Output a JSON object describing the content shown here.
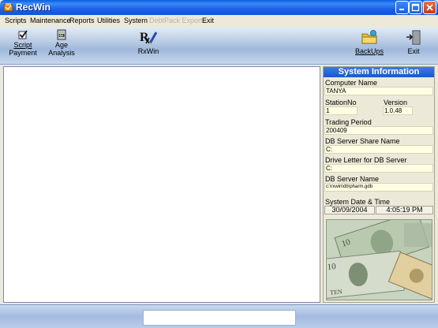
{
  "window": {
    "title": "RecWin"
  },
  "menu": {
    "items": [
      {
        "label": "Scripts",
        "enabled": true
      },
      {
        "label": "Maintenance",
        "enabled": true
      },
      {
        "label": "Reports",
        "enabled": true
      },
      {
        "label": "Utilities",
        "enabled": true
      },
      {
        "label": "System",
        "enabled": true
      },
      {
        "label": "DebtPack Exports",
        "enabled": false
      },
      {
        "label": "Exit",
        "enabled": true
      }
    ]
  },
  "toolbar": {
    "script_payment": {
      "line1": "Script",
      "line2": "Payment",
      "icon": "checkbox-icon"
    },
    "age_analysis": {
      "line1": "Age",
      "line2": "Analysis",
      "icon": "calculator-icon"
    },
    "rxwin": {
      "label": "RxWin",
      "icon": "rx-pen-icon"
    },
    "backups": {
      "label": "BackUps",
      "icon": "folder-icon"
    },
    "exit": {
      "label": "Exit",
      "icon": "exit-door-icon"
    }
  },
  "system_info": {
    "header": "System Information",
    "computer_name_label": "Computer Name",
    "computer_name": "TANYA",
    "station_no_label": "StationNo",
    "station_no": "1",
    "version_label": "Version",
    "version": "1.0.48",
    "trading_period_label": "Trading Period",
    "trading_period": "200409",
    "db_share_label": "DB Server Share Name",
    "db_share": "C:",
    "drive_letter_label": "Drive Letter for DB Server",
    "drive_letter": "C:",
    "db_server_label": "DB Server Name",
    "db_server": "c:\\rxwin\\db\\pharm.gdb",
    "datetime_label": "System Date & Time",
    "date": "30/09/2004",
    "time": "4:05:19 PM"
  },
  "colors": {
    "titlebar": "#1a63e6",
    "panel_header": "#1d56cc",
    "value_field": "#fffde4"
  }
}
